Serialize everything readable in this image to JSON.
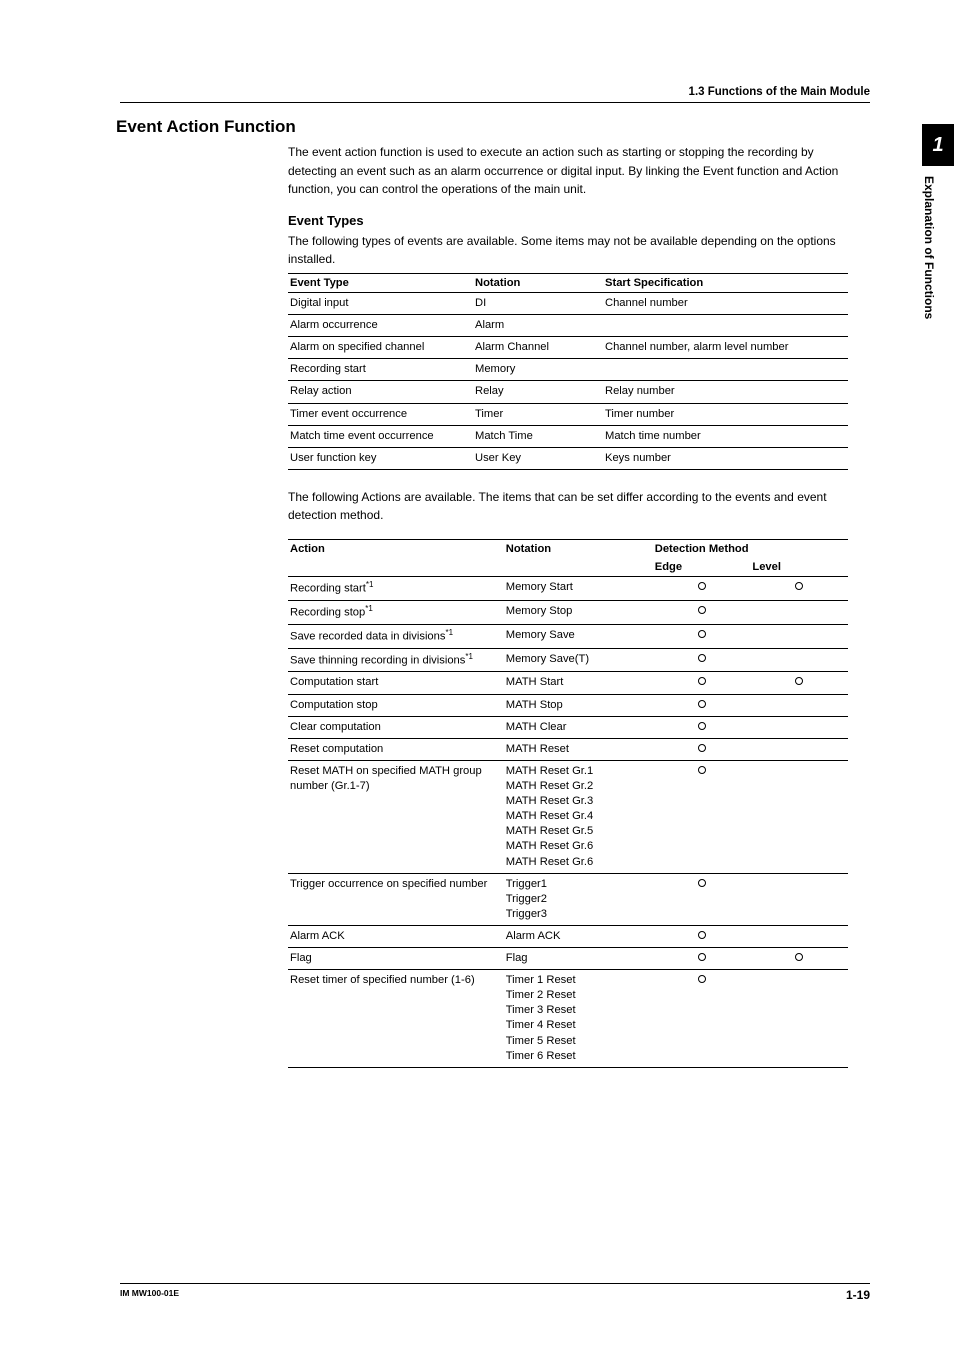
{
  "section_header": "1.3  Functions of the Main Module",
  "tab": {
    "num": "1",
    "label": "Explanation of Functions"
  },
  "h2": "Event Action Function",
  "intro_para": "The event action function is used to execute an action such as starting or stopping the recording by detecting an event such as an alarm occurrence or digital input.\nBy linking the Event function and Action function, you can control the operations of the main unit.",
  "event_types": {
    "heading": "Event Types",
    "intro": "The following types of events are available. Some items may not be available depending on the options installed.",
    "headers": [
      "Event Type",
      "Notation",
      "Start Specification"
    ],
    "rows": [
      [
        "Digital input",
        "DI",
        "Channel number"
      ],
      [
        "Alarm occurrence",
        "Alarm",
        ""
      ],
      [
        "Alarm on specified channel",
        "Alarm Channel",
        "Channel number, alarm level number"
      ],
      [
        "Recording start",
        "Memory",
        ""
      ],
      [
        "Relay action",
        "Relay",
        "Relay number"
      ],
      [
        "Timer event occurrence",
        "Timer",
        "Timer number"
      ],
      [
        "Match time event occurrence",
        "Match Time",
        "Match time number"
      ],
      [
        "User function key",
        "User Key",
        "Keys number"
      ]
    ]
  },
  "actions": {
    "intro": "The following Actions are available. The items that can be set differ according to the events and event detection method.",
    "header_action": "Action",
    "header_notation": "Notation",
    "header_method": "Detection Method",
    "header_edge": "Edge",
    "header_level": "Level",
    "rows": [
      {
        "action": "Recording start",
        "sup": "*1",
        "notation": [
          "Memory Start"
        ],
        "edge": true,
        "level": true
      },
      {
        "action": "Recording stop",
        "sup": "*1",
        "notation": [
          "Memory Stop"
        ],
        "edge": true,
        "level": false
      },
      {
        "action": "Save recorded data in divisions",
        "sup": "*1",
        "notation": [
          "Memory Save"
        ],
        "edge": true,
        "level": false
      },
      {
        "action": "Save thinning recording in divisions",
        "sup": "*1",
        "notation": [
          "Memory Save(T)"
        ],
        "edge": true,
        "level": false
      },
      {
        "action": "Computation start",
        "notation": [
          "MATH Start"
        ],
        "edge": true,
        "level": true
      },
      {
        "action": "Computation stop",
        "notation": [
          "MATH Stop"
        ],
        "edge": true,
        "level": false
      },
      {
        "action": "Clear computation",
        "notation": [
          "MATH Clear"
        ],
        "edge": true,
        "level": false
      },
      {
        "action": "Reset computation",
        "notation": [
          "MATH Reset"
        ],
        "edge": true,
        "level": false
      },
      {
        "action": "Reset MATH on specified MATH group number (Gr.1-7)",
        "notation": [
          "MATH Reset Gr.1",
          "MATH Reset Gr.2",
          "MATH Reset Gr.3",
          "MATH Reset Gr.4",
          "MATH Reset Gr.5",
          "MATH Reset Gr.6",
          "MATH Reset Gr.6"
        ],
        "edge": true,
        "level": false
      },
      {
        "action": "Trigger occurrence on specified number",
        "notation": [
          "Trigger1",
          "Trigger2",
          "Trigger3"
        ],
        "edge": true,
        "level": false
      },
      {
        "action": "Alarm ACK",
        "notation": [
          "Alarm ACK"
        ],
        "edge": true,
        "level": false
      },
      {
        "action": "Flag",
        "notation": [
          "Flag"
        ],
        "edge": true,
        "level": true
      },
      {
        "action": "Reset timer of specified number (1-6)",
        "notation": [
          "Timer 1 Reset",
          "Timer 2 Reset",
          "Timer 3 Reset",
          "Timer 4 Reset",
          "Timer 5 Reset",
          "Timer 6 Reset"
        ],
        "edge": true,
        "level": false
      }
    ]
  },
  "footer": {
    "left": "IM MW100-01E",
    "right": "1-19"
  }
}
